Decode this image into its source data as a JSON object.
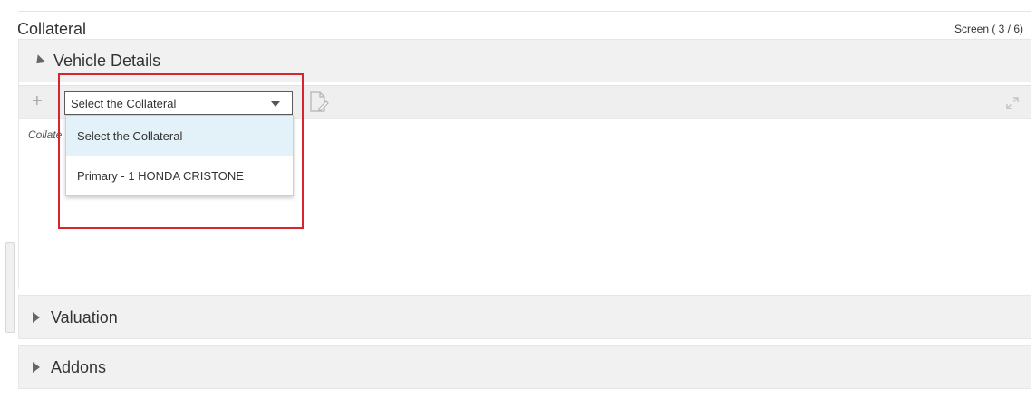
{
  "header": {
    "title": "Collateral",
    "screen_counter": "Screen ( 3 / 6)"
  },
  "sections": {
    "vehicle_details": {
      "label": "Vehicle Details",
      "expanded": true,
      "select": {
        "value": "Select the Collateral",
        "options": [
          "Select the Collateral",
          "Primary - 1 HONDA CRISTONE"
        ],
        "selected_index": 0
      },
      "collateral_label": "Collate"
    },
    "valuation": {
      "label": "Valuation",
      "expanded": false
    },
    "addons": {
      "label": "Addons",
      "expanded": false
    }
  },
  "icons": {
    "add": "plus-icon",
    "edit": "document-edit-icon",
    "expand": "expand-icon",
    "dropdown": "chevron-down-icon"
  },
  "colors": {
    "highlight": "#d9232d",
    "selected_option_bg": "#e3f1f9",
    "section_bg": "#f1f1f1"
  }
}
